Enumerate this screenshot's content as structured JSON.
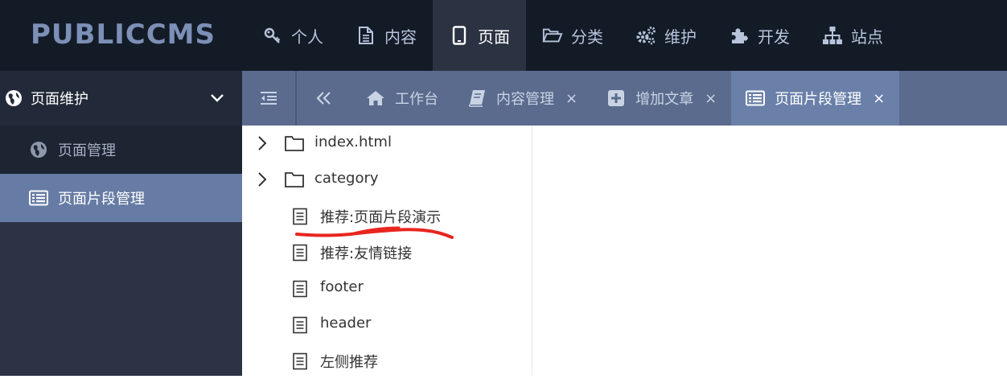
{
  "app": {
    "logo_text": "PUBLICCMS"
  },
  "nav": {
    "items": [
      {
        "label": "个人",
        "icon": "key-icon"
      },
      {
        "label": "内容",
        "icon": "file-text-icon"
      },
      {
        "label": "页面",
        "icon": "tablet-icon",
        "active": true
      },
      {
        "label": "分类",
        "icon": "folder-open-icon"
      },
      {
        "label": "维护",
        "icon": "gears-icon"
      },
      {
        "label": "开发",
        "icon": "puzzle-icon"
      },
      {
        "label": "站点",
        "icon": "sitemap-icon"
      }
    ]
  },
  "sidebar": {
    "header": {
      "title": "页面维护",
      "icon": "globe-icon"
    },
    "items": [
      {
        "label": "页面管理",
        "icon": "globe-icon"
      },
      {
        "label": "页面片段管理",
        "icon": "list-alt-icon",
        "active": true
      }
    ]
  },
  "tabs": [
    {
      "label": "工作台",
      "icon": "home-icon",
      "closable": false
    },
    {
      "label": "内容管理",
      "icon": "book-icon",
      "closable": true
    },
    {
      "label": "增加文章",
      "icon": "plus-square-icon",
      "closable": true
    },
    {
      "label": "页面片段管理",
      "icon": "list-alt-icon",
      "closable": true,
      "active": true
    }
  ],
  "tab_close_glyph": "×",
  "tree": {
    "items": [
      {
        "label": "index.html",
        "type": "folder"
      },
      {
        "label": "category",
        "type": "folder"
      },
      {
        "label": "推荐:页面片段演示",
        "type": "file",
        "annotated": true
      },
      {
        "label": "推荐:友情链接",
        "type": "file"
      },
      {
        "label": "footer",
        "type": "file"
      },
      {
        "label": "header",
        "type": "file"
      },
      {
        "label": "左侧推荐",
        "type": "file"
      }
    ]
  },
  "colors": {
    "topbar": "#131b27",
    "sidebar": "#2b3344",
    "tabbar": "#5a6b8d",
    "active_tab": "#6a80a9",
    "active_sidebar_item": "#677ca4",
    "annotation": "#e8261f"
  }
}
